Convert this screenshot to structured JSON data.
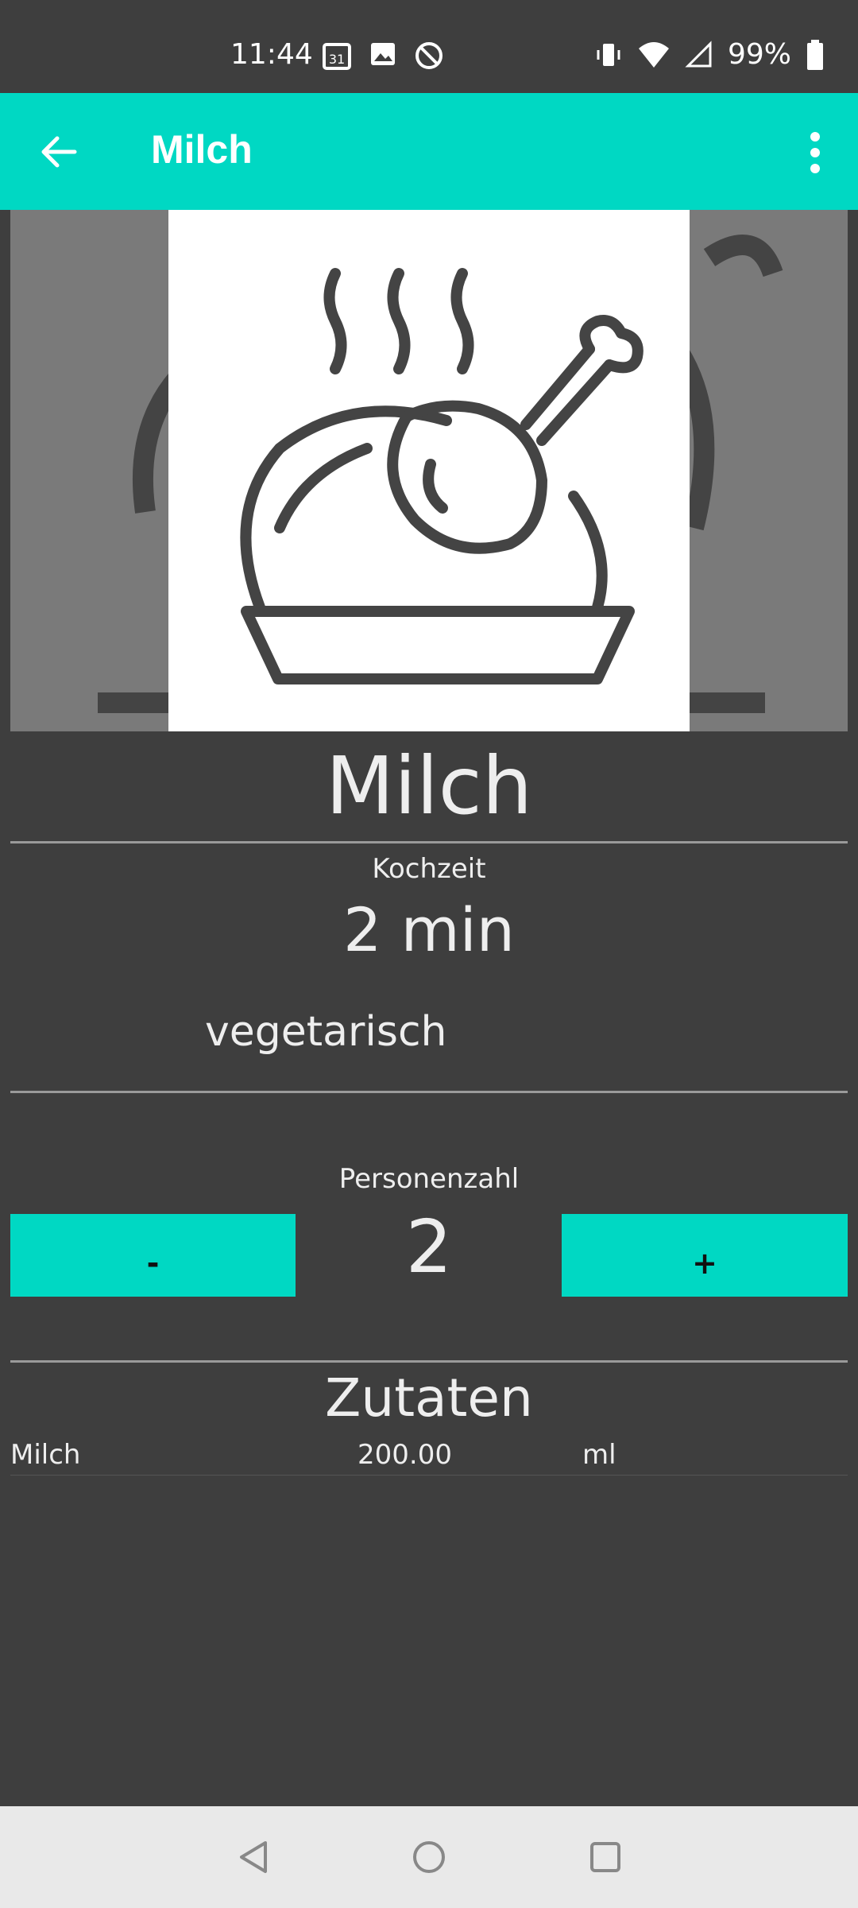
{
  "status_bar": {
    "time": "11:44",
    "battery": "99%",
    "icons_left": [
      "calendar-icon",
      "image-icon",
      "no-disturb-icon"
    ],
    "icons_right": [
      "vibrate-icon",
      "wifi-icon",
      "signal-icon",
      "battery-icon"
    ]
  },
  "app_bar": {
    "title": "Milch",
    "accent_color": "#00d8c3",
    "back_icon": "arrow-back-icon",
    "menu_icon": "more-vert-icon"
  },
  "recipe": {
    "image_icon": "roast-chicken-icon",
    "title": "Milch",
    "cook_time_label": "Kochzeit",
    "cook_time_value": "2 min",
    "category": "vegetarisch"
  },
  "servings": {
    "label": "Personenzahl",
    "value": "2",
    "decrement_label": "-",
    "increment_label": "+"
  },
  "ingredients": {
    "heading": "Zutaten",
    "items": [
      {
        "name": "Milch",
        "quantity": "200.00",
        "unit": "ml"
      }
    ]
  },
  "nav_bar": {
    "buttons": [
      "back-triangle-icon",
      "home-circle-icon",
      "recents-square-icon"
    ]
  }
}
